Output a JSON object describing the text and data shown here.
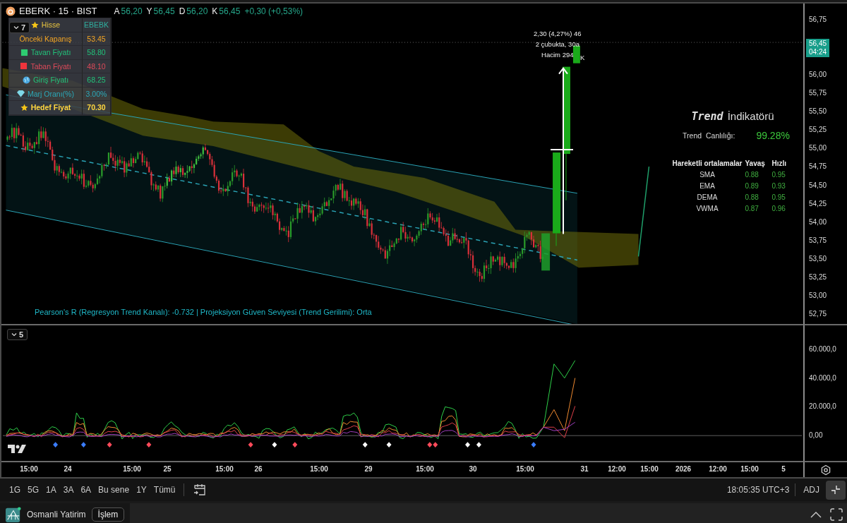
{
  "legend": {
    "title": "EBERK · 15 · BIST",
    "values": [
      {
        "label": "A",
        "value": "56,20"
      },
      {
        "label": "Y",
        "value": "56,45"
      },
      {
        "label": "D",
        "value": "56,20"
      },
      {
        "label": "K",
        "value": "56,45"
      }
    ],
    "change": "+0,30 (+0,53%)"
  },
  "main_pane": {
    "collapse": "7"
  },
  "info_table": [
    {
      "label": "Hisse",
      "value": "EBEBK",
      "color": "#e8c440"
    },
    {
      "label": "Önceki Kapanış",
      "value": "53.45",
      "color": "#f5a623"
    },
    {
      "label": "Tavan Fiyatı",
      "value": "58.80",
      "color": "#22c27a"
    },
    {
      "label": "Taban Fiyatı",
      "value": "48.10",
      "color": "#e04a5a"
    },
    {
      "label": "Giriş Fiyatı",
      "value": "68.25",
      "color": "#22c27a"
    },
    {
      "label": "Marj Oranı(%)",
      "value": "3.00%",
      "color": "#2aa8b8"
    },
    {
      "label": "Hedef Fiyat",
      "value": "70.30",
      "color": "#ffd740"
    }
  ],
  "measure": [
    "2,30 (4,27%) 46",
    "2 çubukta, 30a",
    "Hacim 294",
    "K"
  ],
  "trend_panel": {
    "title_emphasis": "Trend",
    "title_rest": "İndikatörü",
    "vitality_label": "Trend  Canlılığı:",
    "vitality_value": "99.28%",
    "columns": [
      "Hareketli ortalamalar",
      "Yavaş",
      "Hızlı"
    ],
    "rows": [
      {
        "name": "SMA",
        "slow": "0.88",
        "fast": "0.95"
      },
      {
        "name": "EMA",
        "slow": "0.89",
        "fast": "0.93"
      },
      {
        "name": "DEMA",
        "slow": "0.88",
        "fast": "0.95"
      },
      {
        "name": "VWMA",
        "slow": "0.87",
        "fast": "0.96"
      }
    ]
  },
  "pearson": "Pearson's R (Regresyon Trend Kanalı): -0.732 |  Projeksiyon Güven Seviyesi (Trend Gerilimi): Orta",
  "price_axis": [
    "56,75",
    "56,00",
    "55,75",
    "55,50",
    "55,25",
    "55,00",
    "54,75",
    "54,50",
    "54,25",
    "54,00",
    "53,75",
    "53,50",
    "53,25",
    "53,00",
    "52,75"
  ],
  "price_badge": {
    "price": "56,45",
    "countdown": "04:24"
  },
  "lower_pane": {
    "collapse": "5",
    "axis": [
      "60.000,0",
      "40.000,0",
      "20.000,0",
      "0,00"
    ]
  },
  "time_axis": [
    "15:00",
    "24",
    "15:00",
    "25",
    "15:00",
    "26",
    "15:00",
    "29",
    "15:00",
    "30",
    "15:00",
    "31",
    "12:00",
    "15:00",
    "2026",
    "12:00",
    "15:00",
    "5"
  ],
  "toolbar": {
    "ranges": [
      "1G",
      "5G",
      "1A",
      "3A",
      "6A",
      "Bu sene",
      "1Y",
      "Tümü"
    ],
    "clock": "18:05:35 UTC+3",
    "adj": "ADJ"
  },
  "taskbar": {
    "broker": "Osmanli Yatirim",
    "trade": "İşlem"
  }
}
